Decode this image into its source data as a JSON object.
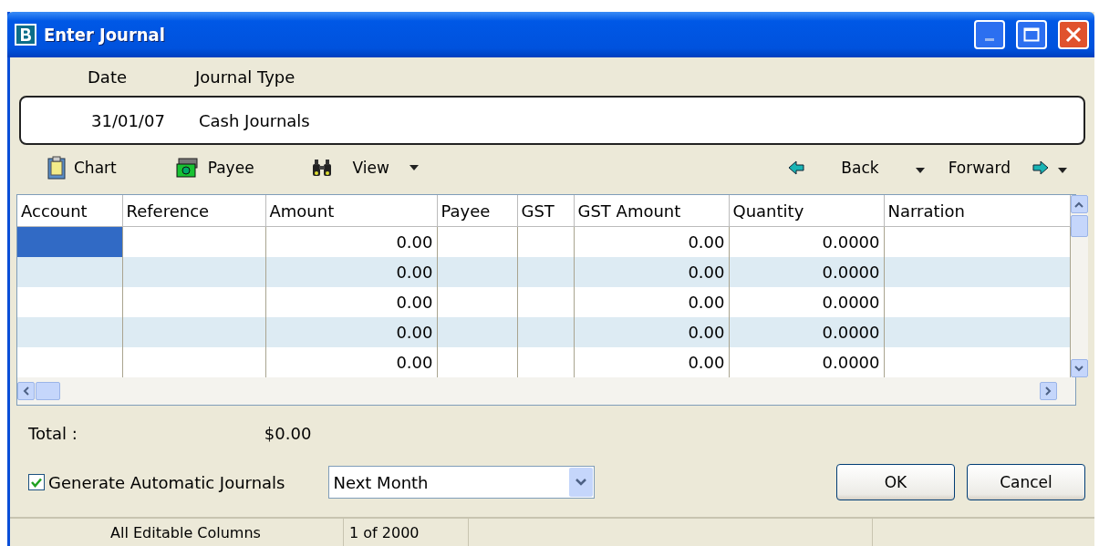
{
  "window": {
    "title": "Enter Journal"
  },
  "header": {
    "labels": [
      "Date",
      "Journal Type"
    ],
    "values": [
      "31/01/07",
      "Cash Journals"
    ]
  },
  "toolbar": {
    "items": [
      {
        "kind": "chart",
        "label": "Chart"
      },
      {
        "kind": "payee",
        "label": "Payee"
      },
      {
        "kind": "view",
        "label": "View"
      }
    ],
    "nav": [
      {
        "kind": "back",
        "label": "Back"
      },
      {
        "kind": "forward",
        "label": "Forward"
      }
    ]
  },
  "table": {
    "columns": [
      "Account",
      "Reference",
      "Amount",
      "Payee",
      "GST",
      "GST Amount",
      "Quantity",
      "Narration"
    ],
    "rows": [
      {
        "selected": true,
        "amount": "0.00",
        "gst_amount": "0.00",
        "quantity": "0.0000"
      },
      {
        "selected": false,
        "amount": "0.00",
        "gst_amount": "0.00",
        "quantity": "0.0000"
      },
      {
        "selected": false,
        "amount": "0.00",
        "gst_amount": "0.00",
        "quantity": "0.0000"
      },
      {
        "selected": false,
        "amount": "0.00",
        "gst_amount": "0.00",
        "quantity": "0.0000"
      },
      {
        "selected": false,
        "amount": "0.00",
        "gst_amount": "0.00",
        "quantity": "0.0000"
      }
    ]
  },
  "footer": {
    "total_label": "Total :",
    "total_value": "$0.00",
    "auto_journals": {
      "label": "Generate Automatic Journals",
      "checked": true
    },
    "frequency": "Next Month",
    "buttons": [
      "OK",
      "Cancel"
    ]
  },
  "status_bar": [
    "All Editable Columns",
    "1 of 2000"
  ]
}
